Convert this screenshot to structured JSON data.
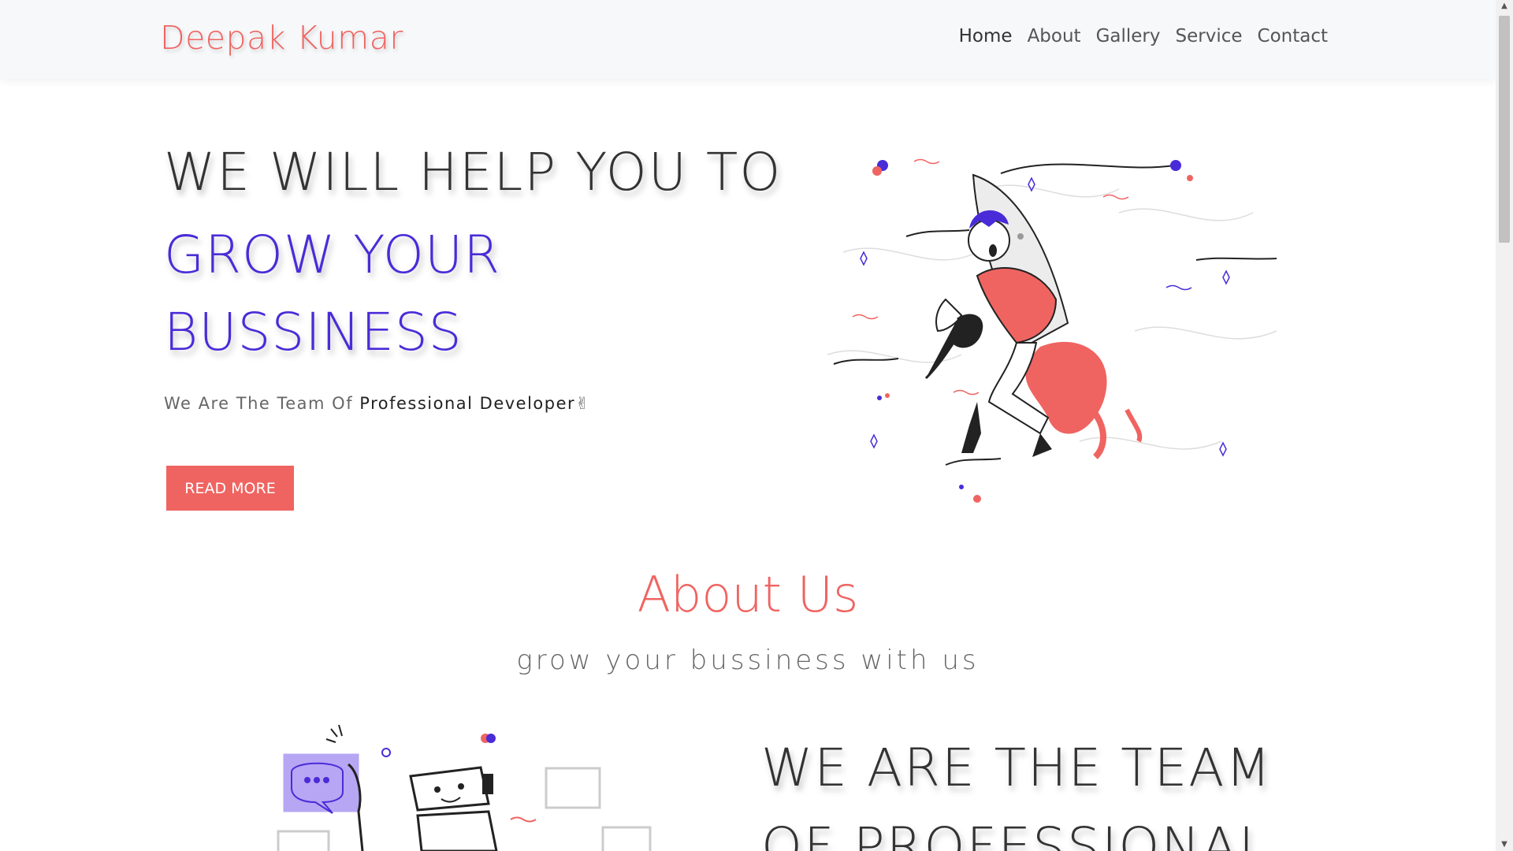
{
  "navbar": {
    "brand": "Deepak Kumar",
    "links": [
      "Home",
      "About",
      "Gallery",
      "Service",
      "Contact"
    ]
  },
  "hero": {
    "line1": "WE WILL HELP YOU TO",
    "line2": "GROW YOUR",
    "line3": "BUSSINESS",
    "sub_prefix": "We Are The Team Of ",
    "sub_strong": "Professional Developer",
    "sub_emoji": "✌",
    "button": "READ MORE"
  },
  "about": {
    "title": "About Us",
    "subtitle": "grow your bussiness with us",
    "heading": "WE ARE THE TEAM OF PROFESSIONAL"
  },
  "colors": {
    "accent": "#ef6461",
    "purple": "#4a2bd8"
  }
}
